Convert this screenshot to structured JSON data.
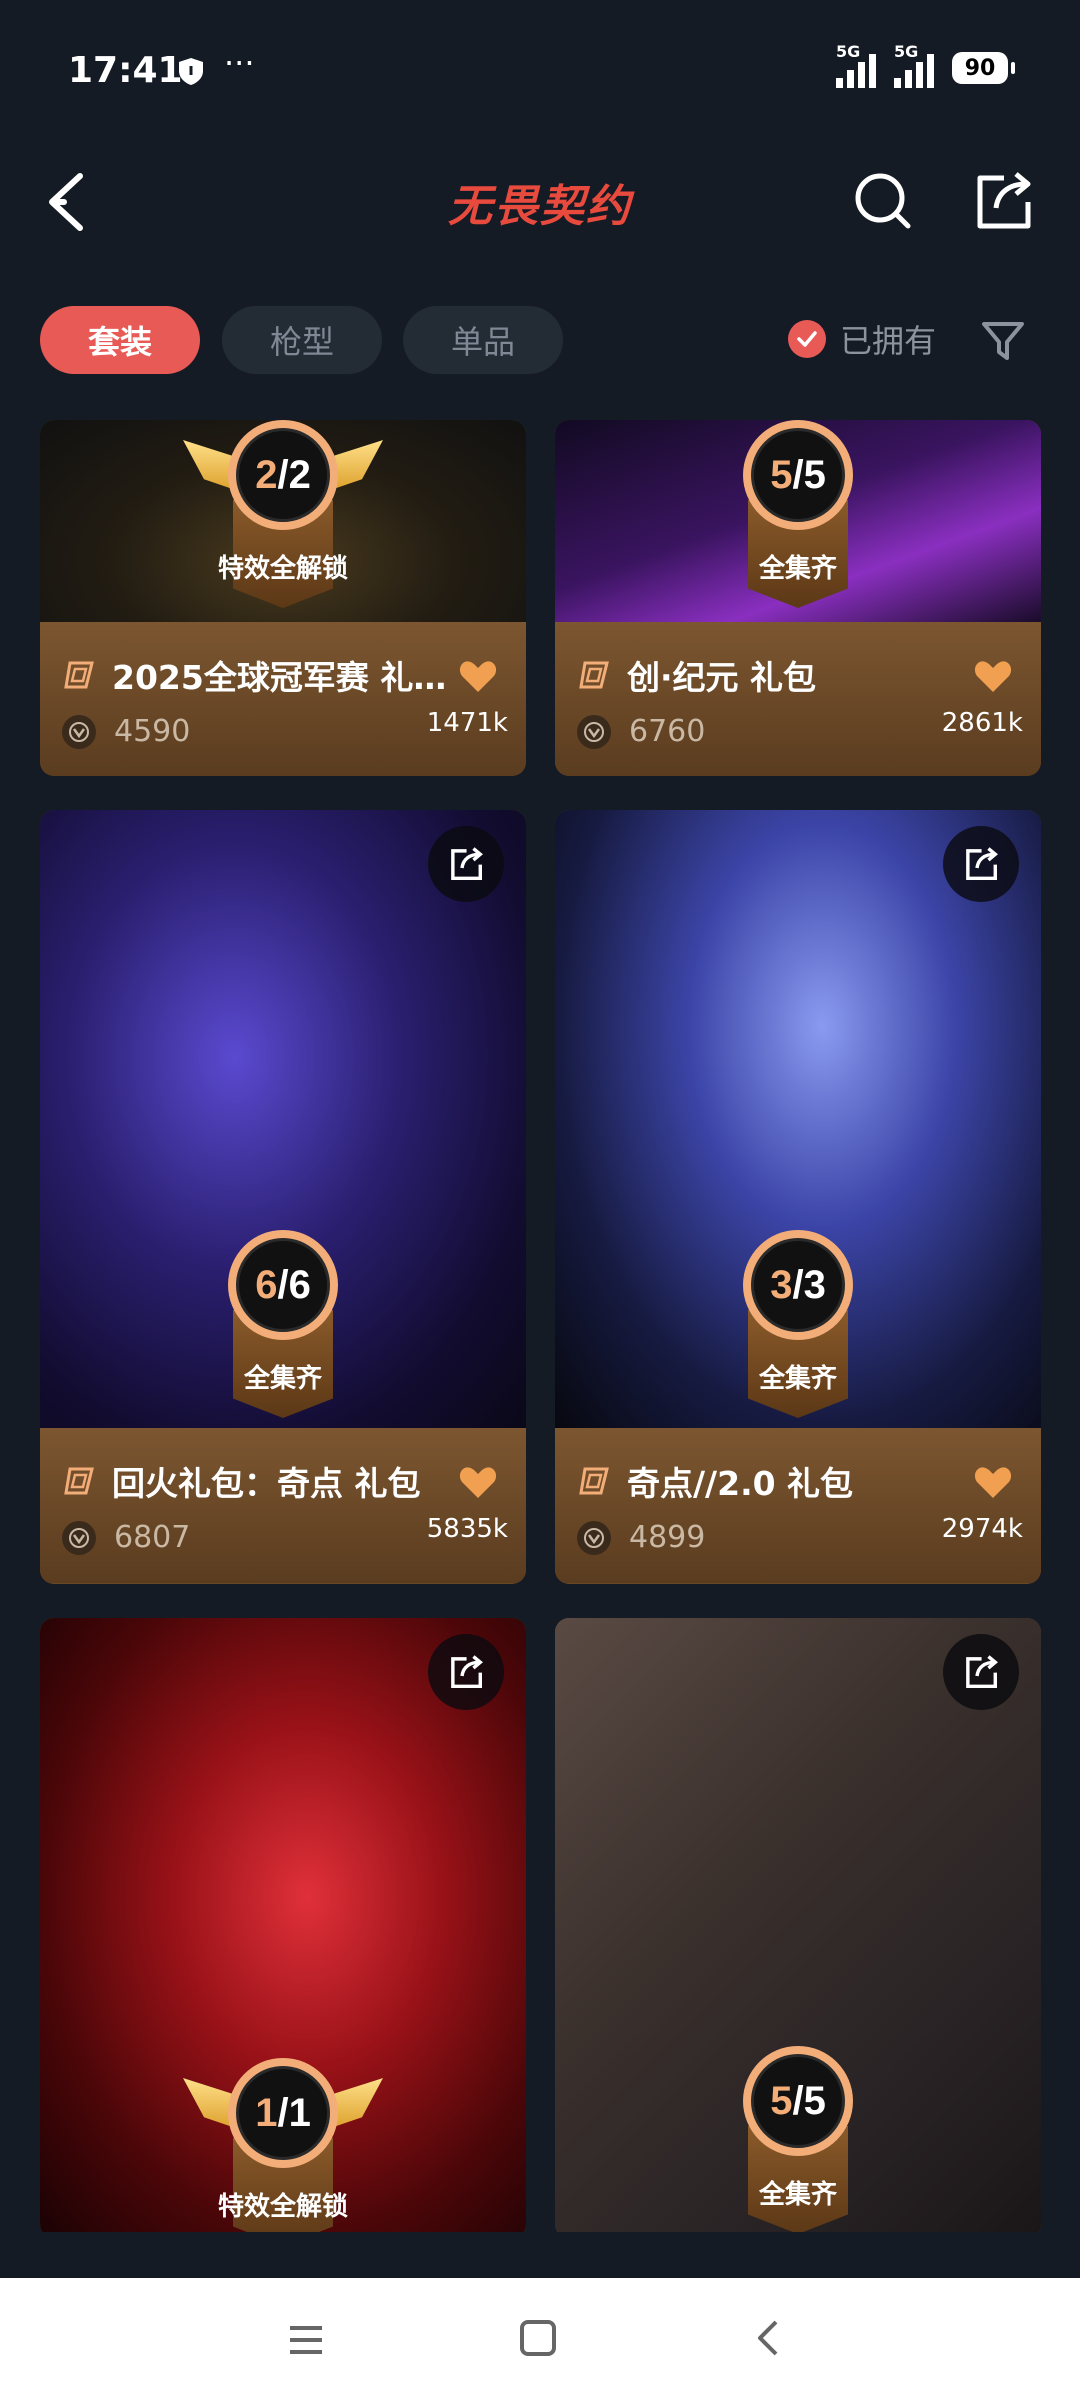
{
  "status": {
    "time": "17:41",
    "dots": "···",
    "net1": "5G",
    "net2": "5G",
    "battery": "90"
  },
  "header": {
    "title": "无畏契约"
  },
  "tabs": [
    {
      "label": "套装"
    },
    {
      "label": "枪型"
    },
    {
      "label": "单品"
    }
  ],
  "owned_filter": {
    "label": "已拥有",
    "checked": true
  },
  "colors": {
    "accent": "#e85a55",
    "badge_ring": "#f2ad78",
    "card_bg": "#6a4826",
    "heart": "#f0a050"
  },
  "cards": [
    {
      "name": "2025全球冠军赛 礼…",
      "price": "4590",
      "likes": "1471k",
      "count": "2",
      "total": "2",
      "badge_label": "特效全解锁",
      "badge_style": "winged"
    },
    {
      "name": "创·纪元 礼包",
      "price": "6760",
      "likes": "2861k",
      "count": "5",
      "total": "5",
      "badge_label": "全集齐",
      "badge_style": "plain"
    },
    {
      "name": "回火礼包：奇点 礼包",
      "price": "6807",
      "likes": "5835k",
      "count": "6",
      "total": "6",
      "badge_label": "全集齐",
      "badge_style": "plain"
    },
    {
      "name": "奇点//2.0 礼包",
      "price": "4899",
      "likes": "2974k",
      "count": "3",
      "total": "3",
      "badge_label": "全集齐",
      "badge_style": "plain"
    },
    {
      "count": "1",
      "total": "1",
      "badge_label": "特效全解锁",
      "badge_style": "winged"
    },
    {
      "count": "5",
      "total": "5",
      "badge_label": "全集齐",
      "badge_style": "plain"
    }
  ]
}
